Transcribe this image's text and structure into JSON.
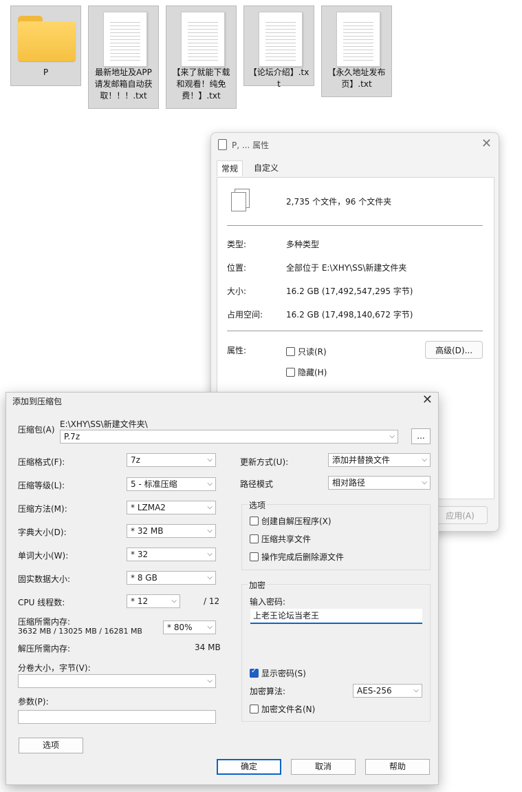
{
  "desktop": {
    "items": [
      {
        "name": "P",
        "type": "folder"
      },
      {
        "name": "最新地址及APP请发邮箱自动获取！！！.txt",
        "type": "text-file"
      },
      {
        "name": "【来了就能下载和观看！纯免费！】.txt",
        "type": "text-file"
      },
      {
        "name": "【论坛介绍】.txt",
        "type": "text-file"
      },
      {
        "name": "【永久地址发布页】.txt",
        "type": "text-file"
      }
    ]
  },
  "properties": {
    "title": "P, ... 属性",
    "tabs": [
      "常规",
      "自定义"
    ],
    "summary": "2,735 个文件，96 个文件夹",
    "type_label": "类型:",
    "type_value": "多种类型",
    "location_label": "位置:",
    "location_value": "全部位于 E:\\XHY\\SS\\新建文件夹",
    "size_label": "大小:",
    "size_value": "16.2 GB (17,492,547,295 字节)",
    "disk_label": "占用空间:",
    "disk_value": "16.2 GB (17,498,140,672 字节)",
    "attr_label": "属性:",
    "readonly_label": "只读(R)",
    "hidden_label": "隐藏(H)",
    "advanced_label": "高级(D)...",
    "apply_label": "应用(A)"
  },
  "archive_dialog": {
    "title": "添加到压缩包",
    "archive_label": "压缩包(A)",
    "archive_path": "E:\\XHY\\SS\\新建文件夹\\",
    "archive_name": "P.7z",
    "browse_label": "...",
    "format_label": "压缩格式(F):",
    "format_value": "7z",
    "level_label": "压缩等级(L):",
    "level_value": "5 - 标准压缩",
    "method_label": "压缩方法(M):",
    "method_value": "*  LZMA2",
    "dict_label": "字典大小(D):",
    "dict_value": "*  32 MB",
    "word_label": "单词大小(W):",
    "word_value": "*  32",
    "solid_label": "固实数据大小:",
    "solid_value": "*  8 GB",
    "threads_label": "CPU 线程数:",
    "threads_value": "*  12",
    "threads_max": "/ 12",
    "mem_compress_label": "压缩所需内存:",
    "mem_compress_value": "3632 MB / 13025 MB / 16281 MB",
    "mem_percent": "*  80%",
    "mem_decompress_label": "解压所需内存:",
    "mem_decompress_value": "34 MB",
    "split_label": "分卷大小，字节(V):",
    "split_value": "",
    "params_label": "参数(P):",
    "params_value": "",
    "options_button": "选项",
    "update_label": "更新方式(U):",
    "update_value": "添加并替换文件",
    "path_label": "路径模式",
    "path_value": "相对路径",
    "options_group": "选项",
    "opt_sfx": "创建自解压程序(X)",
    "opt_shared": "压缩共享文件",
    "opt_delete": "操作完成后删除源文件",
    "encrypt_group": "加密",
    "password_label": "输入密码:",
    "password_value": "上老王论坛当老王",
    "show_password": "显示密码(S)",
    "enc_method_label": "加密算法:",
    "enc_method_value": "AES-256",
    "enc_names": "加密文件名(N)",
    "ok": "确定",
    "cancel": "取消",
    "help": "帮助"
  }
}
